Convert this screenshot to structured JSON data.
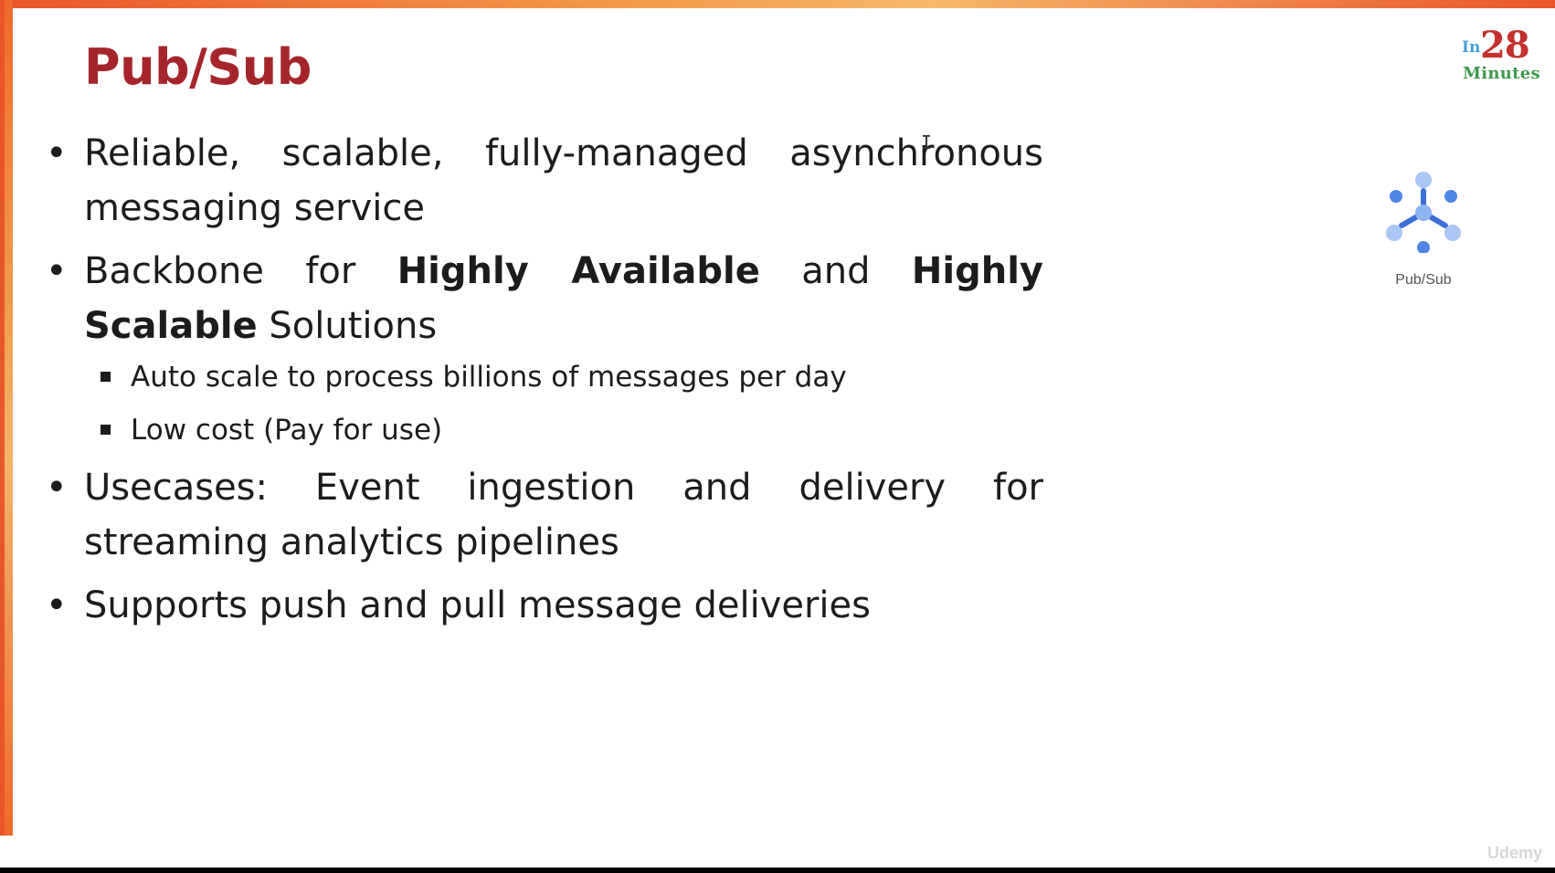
{
  "slide": {
    "title": "Pub/Sub",
    "logo": {
      "prefix": "In",
      "number": "28",
      "word": "Minutes"
    },
    "service_icon": {
      "icon": "pubsub-icon",
      "caption": "Pub/Sub"
    },
    "bullets": [
      {
        "text": "Reliable, scalable, fully-managed asynchronous messaging service"
      },
      {
        "parts": [
          "Backbone for ",
          "Highly Available",
          " and ",
          "Highly Scalable",
          " Solutions"
        ],
        "subitems": [
          "Auto scale to process billions of messages per day",
          "Low cost (Pay for use)"
        ]
      },
      {
        "text": "Usecases: Event ingestion and delivery for streaming analytics pipelines"
      },
      {
        "text": "Supports push and pull message deliveries"
      }
    ],
    "watermark": "Udemy"
  },
  "colors": {
    "title": "#a5262a",
    "accent_border": "#ef6a2d",
    "icon_blue": "#4f86e6"
  }
}
